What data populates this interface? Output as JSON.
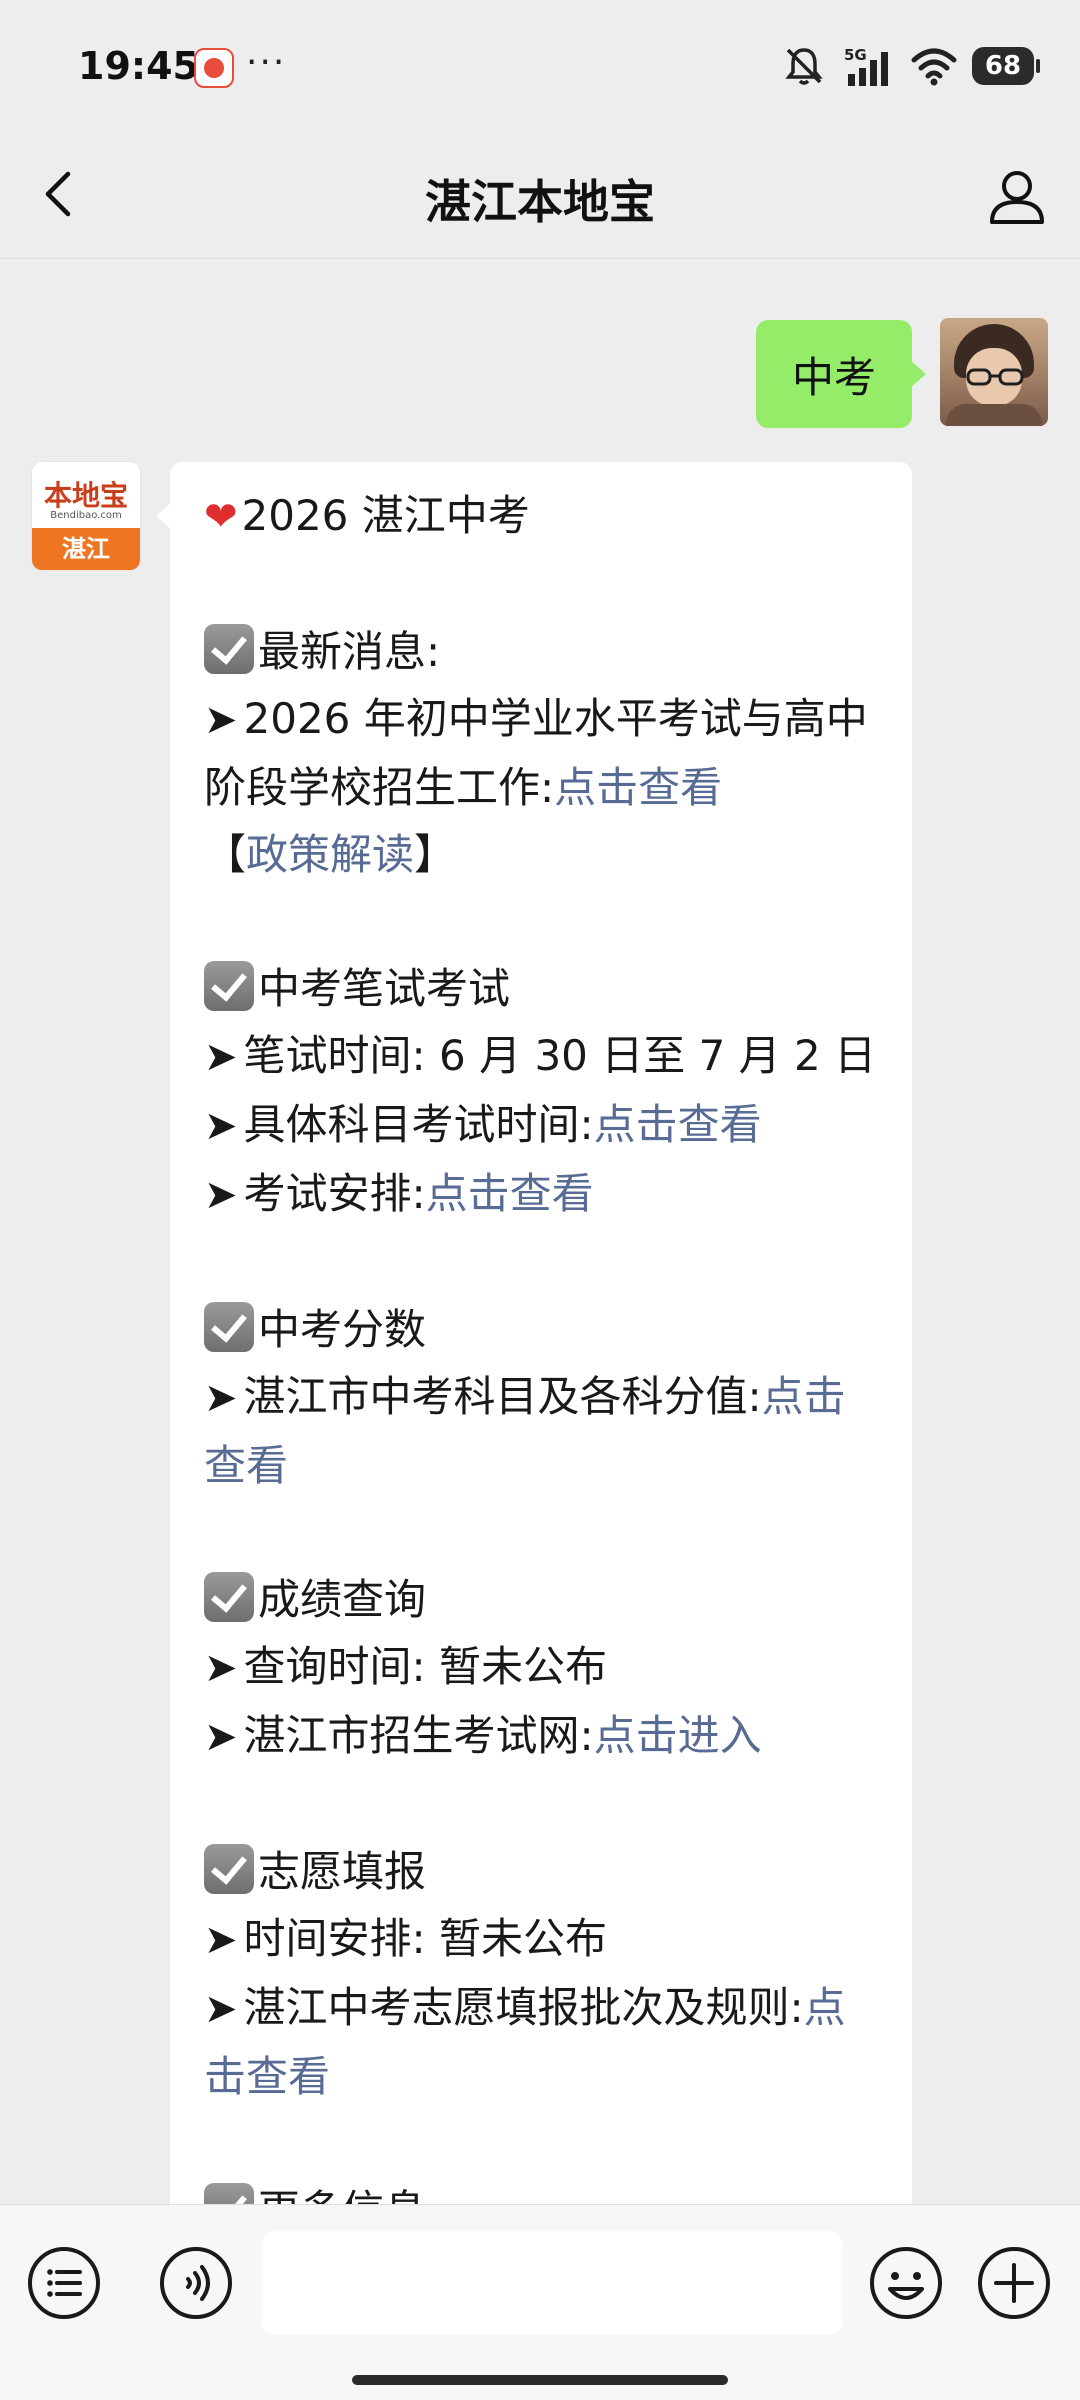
{
  "status_bar": {
    "time": "19:45",
    "more": "···",
    "network": "5G",
    "battery": "68",
    "icons": [
      "app-notification-icon",
      "mute-icon",
      "signal-icon",
      "wifi-icon",
      "battery-icon"
    ]
  },
  "header": {
    "title": "湛江本地宝",
    "left_icon": "back-arrow-icon",
    "right_icon": "user-profile-icon"
  },
  "chat": {
    "user_message": "中考",
    "bot_avatar": {
      "brand": "本地宝",
      "url": "Bendibao.com",
      "city": "湛江"
    },
    "bot_message": {
      "title": "2026 湛江中考",
      "sections": [
        {
          "heading": "最新消息:",
          "lines": [
            {
              "prefix": "➤",
              "text": "2026 年初中学业水平考试与高中阶段学校招生工作:",
              "link": "点击查看"
            },
            {
              "prefix": "",
              "text": "【",
              "link": "政策解读",
              "suffix": "】"
            }
          ]
        },
        {
          "heading": "中考笔试考试",
          "lines": [
            {
              "prefix": "➤",
              "text": "笔试时间: 6 月 30 日至 7 月 2 日",
              "link": ""
            },
            {
              "prefix": "➤",
              "text": "具体科目考试时间:",
              "link": "点击查看"
            },
            {
              "prefix": "➤",
              "text": "考试安排:",
              "link": "点击查看"
            }
          ]
        },
        {
          "heading": "中考分数",
          "lines": [
            {
              "prefix": "➤",
              "text": "湛江市中考科目及各科分值:",
              "link": "点击查看"
            }
          ]
        },
        {
          "heading": "成绩查询",
          "lines": [
            {
              "prefix": "➤",
              "text": "查询时间: 暂未公布",
              "link": ""
            },
            {
              "prefix": "➤",
              "text": "湛江市招生考试网:",
              "link": "点击进入"
            }
          ]
        },
        {
          "heading": "志愿填报",
          "lines": [
            {
              "prefix": "➤",
              "text": "时间安排: 暂未公布",
              "link": ""
            },
            {
              "prefix": "➤",
              "text": "湛江中考志愿填报批次及规则:",
              "link": "点击查看"
            }
          ]
        },
        {
          "heading": "更多信息",
          "lines": []
        }
      ]
    }
  },
  "input_bar": {
    "icons": [
      "menu-list-icon",
      "voice-toggle-icon",
      "microphone-icon",
      "emoji-icon",
      "add-icon"
    ],
    "value": ""
  },
  "colors": {
    "background": "#ededed",
    "user_bubble": "#95ec69",
    "link": "#576b95",
    "bot_bubble": "#ffffff"
  }
}
